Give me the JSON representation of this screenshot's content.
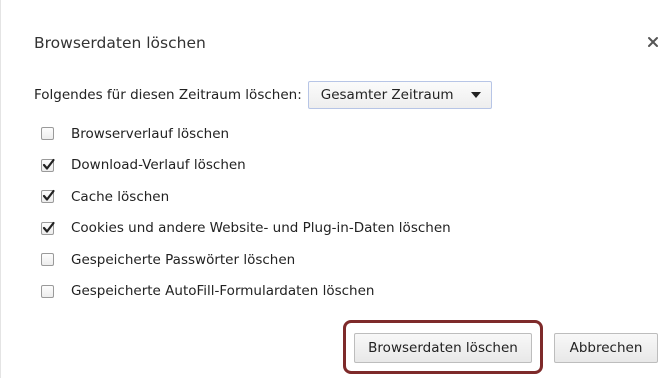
{
  "dialog": {
    "title": "Browserdaten löschen",
    "close_icon": "close-icon"
  },
  "time_range": {
    "label": "Folgendes für diesen Zeitraum löschen:",
    "selected": "Gesamter Zeitraum",
    "dropdown_icon": "caret-down-icon"
  },
  "options": [
    {
      "label": "Browserverlauf löschen",
      "checked": false
    },
    {
      "label": "Download-Verlauf löschen",
      "checked": true
    },
    {
      "label": "Cache löschen",
      "checked": true
    },
    {
      "label": "Cookies und andere Website- und Plug-in-Daten löschen",
      "checked": true
    },
    {
      "label": "Gespeicherte Passwörter löschen",
      "checked": false
    },
    {
      "label": "Gespeicherte AutoFill-Formulardaten löschen",
      "checked": false
    }
  ],
  "buttons": {
    "clear_label": "Browserdaten löschen",
    "cancel_label": "Abbrechen"
  },
  "colors": {
    "highlight_border": "#7e2a2a"
  }
}
